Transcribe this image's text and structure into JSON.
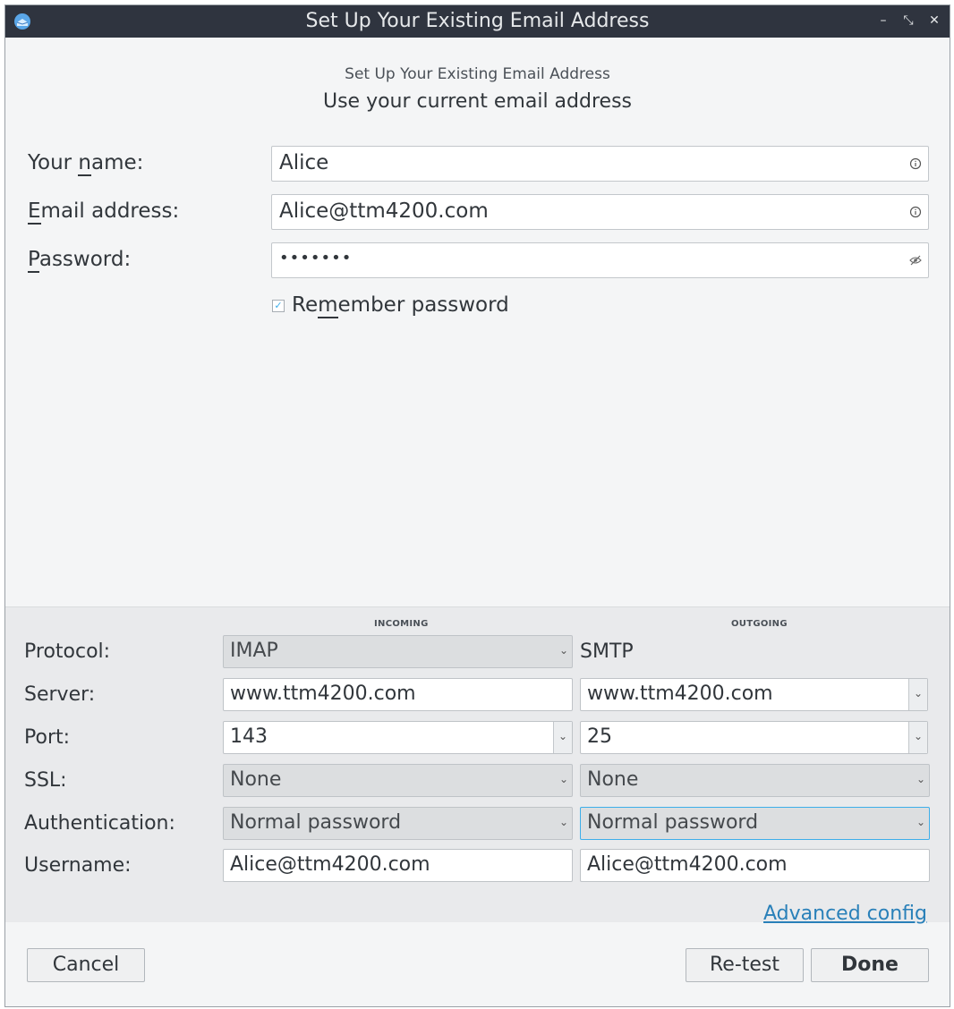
{
  "window": {
    "title": "Set Up Your Existing Email Address"
  },
  "header": {
    "subtitle": "Set Up Your Existing Email Address",
    "heading": "Use your current email address"
  },
  "form": {
    "name_label": "Your name:",
    "name_value": "Alice",
    "email_label": "Email address:",
    "email_value": "Alice@ttm4200.com",
    "password_label": "Password:",
    "password_value": "•••••••",
    "remember_label": "Remember password",
    "remember_checked": true
  },
  "config": {
    "incoming_header": "INCOMING",
    "outgoing_header": "OUTGOING",
    "protocol_label": "Protocol:",
    "server_label": "Server:",
    "port_label": "Port:",
    "ssl_label": "SSL:",
    "auth_label": "Authentication:",
    "username_label": "Username:",
    "incoming": {
      "protocol": "IMAP",
      "server": "www.ttm4200.com",
      "port": "143",
      "ssl": "None",
      "auth": "Normal password",
      "username": "Alice@ttm4200.com"
    },
    "outgoing": {
      "protocol": "SMTP",
      "server": "www.ttm4200.com",
      "port": "25",
      "ssl": "None",
      "auth": "Normal password",
      "username": "Alice@ttm4200.com"
    },
    "advanced_link": "Advanced config"
  },
  "buttons": {
    "cancel": "Cancel",
    "retest": "Re-test",
    "done": "Done"
  },
  "colors": {
    "titlebar": "#2f343f",
    "accent": "#3daee9",
    "link": "#2980b9"
  }
}
